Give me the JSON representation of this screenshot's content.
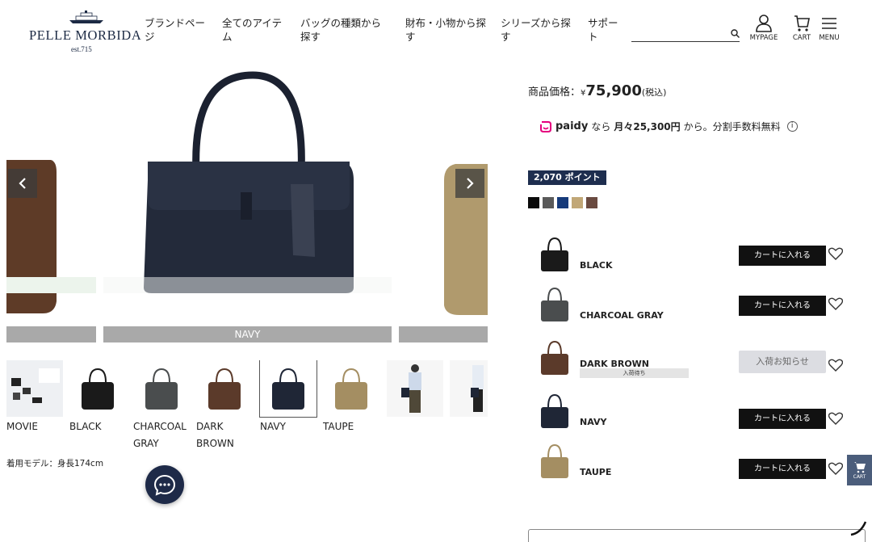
{
  "brand": {
    "name": "PELLE MORBIDA",
    "est": "est.715"
  },
  "nav": [
    {
      "label": "ブランドペー\nジ"
    },
    {
      "label": "全てのアイテ\nム"
    },
    {
      "label": "バッグの種類から\n探す"
    },
    {
      "label": "財布・小物から探\nす"
    },
    {
      "label": "シリーズから探\nす"
    },
    {
      "label": "サポー\nト"
    }
  ],
  "search": {
    "value": "",
    "placeholder": ""
  },
  "header_buttons": {
    "mypage": "MYPAGE",
    "cart": "CART",
    "menu": "MENU"
  },
  "gallery": {
    "current_label": "NAVY",
    "thumbnails": [
      {
        "label": "MOVIE",
        "icon": "movie-thumbnail"
      },
      {
        "label": "BLACK",
        "color": "#1a1a1a"
      },
      {
        "label": "CHARCOAL\nGRAY",
        "color": "#4a4d4e"
      },
      {
        "label": "DARK\nBROWN",
        "color": "#5b3a2a"
      },
      {
        "label": "NAVY",
        "color": "#1f2636"
      },
      {
        "label": "TAUPE",
        "color": "#a48e62"
      },
      {
        "label": "",
        "icon": "model-photo"
      },
      {
        "label": "",
        "icon": "model-photo"
      }
    ],
    "model_note": "着用モデル：身長174cm"
  },
  "product": {
    "price_label": "商品価格：",
    "price_yen": "¥",
    "price_value": "75,900",
    "price_tax": "(税込)",
    "paidy_logo": "paidy",
    "paidy_text_pre": "なら",
    "paidy_monthly": "月々25,300円",
    "paidy_text_post": "から。分割手数料無料",
    "points": "2,070 ポイント",
    "swatches": [
      "#0a0a0a",
      "#5a5a5a",
      "#163a7a",
      "#c1a777",
      "#6a4a40"
    ]
  },
  "variants": [
    {
      "name": "BLACK",
      "color": "#1a1a1a",
      "button": "カートに入れる",
      "status": ""
    },
    {
      "name": "CHARCOAL GRAY",
      "color": "#4a4d4e",
      "button": "カートに入れる",
      "status": ""
    },
    {
      "name": "DARK BROWN",
      "color": "#5b3a2a",
      "button": "入荷お知らせ",
      "status": "入荷待ち"
    },
    {
      "name": "NAVY",
      "color": "#1f2636",
      "button": "カートに入れる",
      "status": ""
    },
    {
      "name": "TAUPE",
      "color": "#a48e62",
      "button": "カートに入れる",
      "status": ""
    }
  ],
  "side_cart_label": "CART",
  "colors": {
    "accent": "#1e2e4f",
    "cart_button": "#111111",
    "gray_label": "#a9a9a9"
  }
}
